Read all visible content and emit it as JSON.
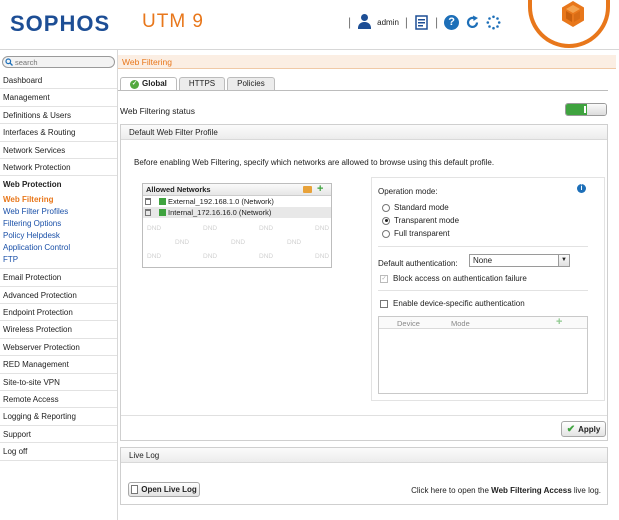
{
  "header": {
    "brand": "SOPHOS",
    "product": "UTM 9",
    "user": "admin",
    "separator": "|",
    "help_glyph": "?",
    "icons": [
      "user-icon",
      "clipboard-icon",
      "help-icon",
      "refresh-icon",
      "activity-spinner-icon"
    ]
  },
  "sidebar": {
    "search_placeholder": "search",
    "items_top": [
      "Dashboard",
      "Management",
      "Definitions & Users",
      "Interfaces & Routing",
      "Network Services",
      "Network Protection"
    ],
    "group": "Web Protection",
    "sub_items": [
      "Web Filtering",
      "Web Filter Profiles",
      "Filtering Options",
      "Policy Helpdesk",
      "Application Control",
      "FTP"
    ],
    "active_sub": "Web Filtering",
    "items_bottom": [
      "Email Protection",
      "Advanced Protection",
      "Endpoint Protection",
      "Wireless Protection",
      "Webserver Protection",
      "RED Management",
      "Site-to-site VPN",
      "Remote Access",
      "Logging & Reporting",
      "Support",
      "Log off"
    ]
  },
  "main": {
    "breadcrumb": "Web Filtering",
    "tabs": [
      {
        "label": "Global",
        "active": true,
        "icon": "check-circle-icon"
      },
      {
        "label": "HTTPS",
        "active": false
      },
      {
        "label": "Policies",
        "active": false
      }
    ],
    "status_label": "Web Filtering status",
    "status_enabled": true,
    "colors": {
      "accent": "#e8771b",
      "brand": "#1d4e95",
      "enabled": "#3fa33f"
    },
    "profile": {
      "title": "Default Web Filter Profile",
      "intro": "Before enabling Web Filtering, specify which networks are allowed to browse using this default profile.",
      "networks_header": "Allowed Networks",
      "networks": [
        "External_192.168.1.0 (Network)",
        "Internal_172.16.16.0 (Network)"
      ],
      "dnd_text": "DND",
      "plus_glyph": "+",
      "info_glyph": "i",
      "operation_mode_label": "Operation mode:",
      "modes": [
        {
          "label": "Standard mode",
          "selected": false
        },
        {
          "label": "Transparent mode",
          "selected": true
        },
        {
          "label": "Full transparent",
          "selected": false
        }
      ],
      "default_auth_label": "Default authentication:",
      "default_auth_value": "None",
      "select_arrow_glyph": "▼",
      "block_label": "Block access on authentication failure",
      "block_checked": true,
      "block_check_glyph": "✓",
      "device_auth_label": "Enable device-specific authentication",
      "device_auth_checked": false,
      "device_columns": [
        "Device",
        "Mode"
      ],
      "apply_label": "Apply",
      "apply_glyph": "✔"
    },
    "live_log": {
      "title": "Live Log",
      "button_label": "Open Live Log",
      "hint_before": "Click here to open the ",
      "hint_bold": "Web Filtering Access",
      "hint_after": " live log."
    }
  }
}
